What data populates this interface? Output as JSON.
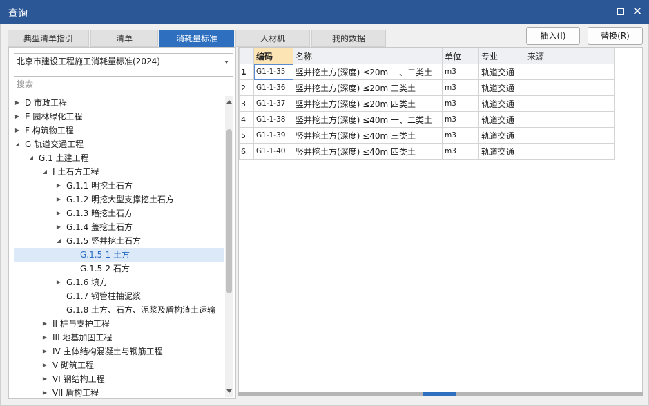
{
  "window": {
    "title": "查询"
  },
  "tabs": [
    {
      "label": "典型清单指引",
      "active": false
    },
    {
      "label": "清单",
      "active": false
    },
    {
      "label": "消耗量标准",
      "active": true
    },
    {
      "label": "人材机",
      "active": false
    },
    {
      "label": "我的数据",
      "active": false
    }
  ],
  "actions": {
    "insert_label": "插入(I)",
    "replace_label": "替换(R)"
  },
  "left": {
    "standard_selected": "北京市建设工程施工消耗量标准(2024)",
    "search_placeholder": "搜索"
  },
  "tree": [
    {
      "label": "D 市政工程",
      "level": 0,
      "arrow": "right"
    },
    {
      "label": "E 园林绿化工程",
      "level": 0,
      "arrow": "right"
    },
    {
      "label": "F 构筑物工程",
      "level": 0,
      "arrow": "right"
    },
    {
      "label": "G 轨道交通工程",
      "level": 0,
      "arrow": "down"
    },
    {
      "label": "G.1 土建工程",
      "level": 1,
      "arrow": "down"
    },
    {
      "label": "I 土石方工程",
      "level": 2,
      "arrow": "down"
    },
    {
      "label": "G.1.1 明挖土石方",
      "level": 3,
      "arrow": "right"
    },
    {
      "label": "G.1.2 明挖大型支撑挖土石方",
      "level": 3,
      "arrow": "right"
    },
    {
      "label": "G.1.3 暗挖土石方",
      "level": 3,
      "arrow": "right"
    },
    {
      "label": "G.1.4 盖挖土石方",
      "level": 3,
      "arrow": "right"
    },
    {
      "label": "G.1.5 竖井挖土石方",
      "level": 3,
      "arrow": "down"
    },
    {
      "label": "G.1.5-1 土方",
      "level": 4,
      "arrow": "",
      "selected": true
    },
    {
      "label": "G.1.5-2 石方",
      "level": 4,
      "arrow": ""
    },
    {
      "label": "G.1.6 填方",
      "level": 3,
      "arrow": "right"
    },
    {
      "label": "G.1.7 钢管柱抽泥浆",
      "level": 3,
      "arrow": ""
    },
    {
      "label": "G.1.8 土方、石方、泥浆及盾构渣土运输",
      "level": 3,
      "arrow": ""
    },
    {
      "label": "II 桩与支护工程",
      "level": 2,
      "arrow": "right"
    },
    {
      "label": "III 地基加固工程",
      "level": 2,
      "arrow": "right"
    },
    {
      "label": "IV 主体结构混凝土与钢筋工程",
      "level": 2,
      "arrow": "right"
    },
    {
      "label": "V 砌筑工程",
      "level": 2,
      "arrow": "right"
    },
    {
      "label": "VI 钢结构工程",
      "level": 2,
      "arrow": "right"
    },
    {
      "label": "VII 盾构工程",
      "level": 2,
      "arrow": "right"
    }
  ],
  "grid": {
    "columns": [
      "编码",
      "名称",
      "单位",
      "专业",
      "来源"
    ],
    "rows": [
      {
        "num": "1",
        "code": "G1-1-35",
        "name": "竖井挖土方(深度) ≤20m 一、二类土",
        "unit": "m3",
        "major": "轨道交通",
        "source": ""
      },
      {
        "num": "2",
        "code": "G1-1-36",
        "name": "竖井挖土方(深度) ≤20m 三类土",
        "unit": "m3",
        "major": "轨道交通",
        "source": ""
      },
      {
        "num": "3",
        "code": "G1-1-37",
        "name": "竖井挖土方(深度) ≤20m 四类土",
        "unit": "m3",
        "major": "轨道交通",
        "source": ""
      },
      {
        "num": "4",
        "code": "G1-1-38",
        "name": "竖井挖土方(深度) ≤40m 一、二类土",
        "unit": "m3",
        "major": "轨道交通",
        "source": ""
      },
      {
        "num": "5",
        "code": "G1-1-39",
        "name": "竖井挖土方(深度) ≤40m 三类土",
        "unit": "m3",
        "major": "轨道交通",
        "source": ""
      },
      {
        "num": "6",
        "code": "G1-1-40",
        "name": "竖井挖土方(深度) ≤40m 四类土",
        "unit": "m3",
        "major": "轨道交通",
        "source": ""
      }
    ]
  },
  "colors": {
    "titlebar": "#2b5797",
    "active_tab": "#2e6fc0",
    "selected_row": "#dce9f8",
    "active_header": "#fde4b5"
  }
}
